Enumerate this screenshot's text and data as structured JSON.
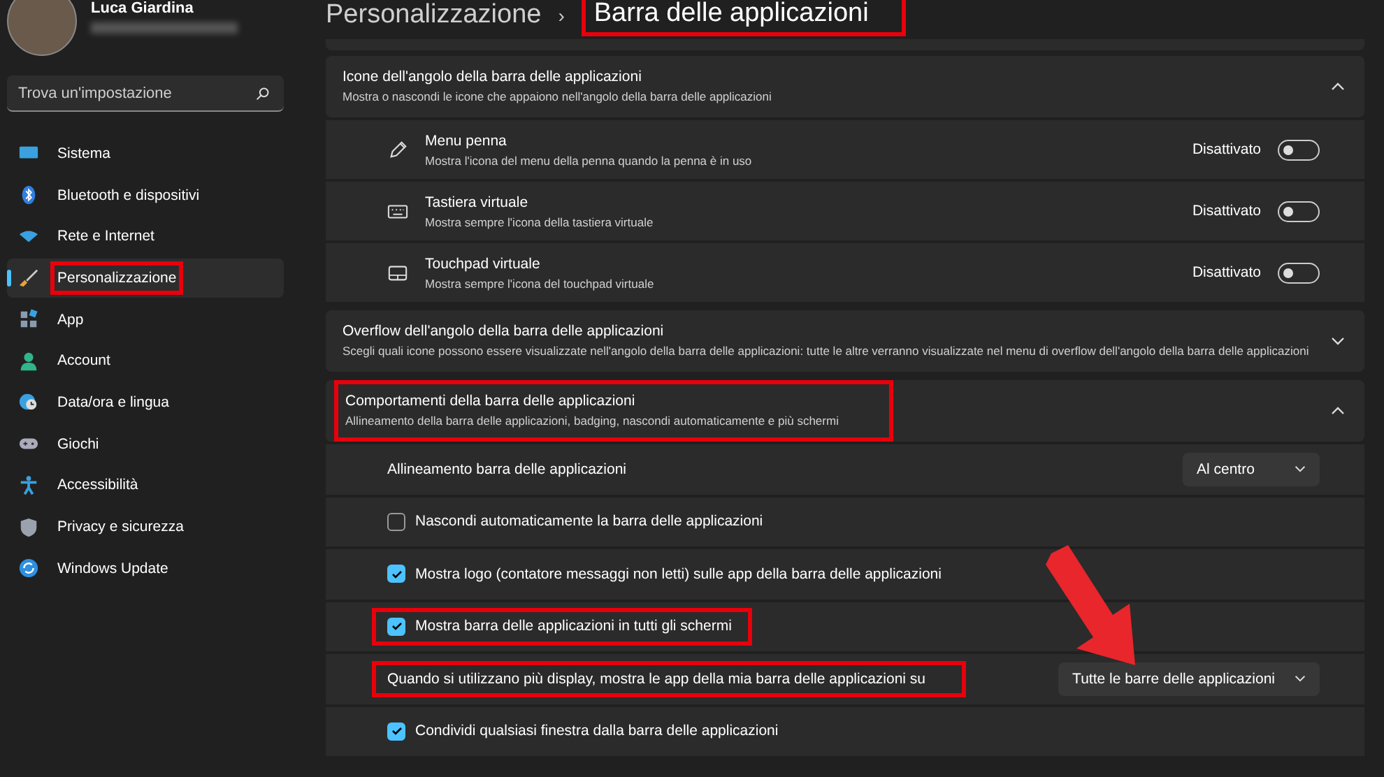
{
  "profile": {
    "name": "Luca Giardina"
  },
  "search": {
    "placeholder": "Trova un'impostazione"
  },
  "nav": [
    {
      "label": "Sistema",
      "selected": false,
      "highlighted": false
    },
    {
      "label": "Bluetooth e dispositivi",
      "selected": false,
      "highlighted": false
    },
    {
      "label": "Rete e Internet",
      "selected": false,
      "highlighted": false
    },
    {
      "label": "Personalizzazione",
      "selected": true,
      "highlighted": true
    },
    {
      "label": "App",
      "selected": false,
      "highlighted": false
    },
    {
      "label": "Account",
      "selected": false,
      "highlighted": false
    },
    {
      "label": "Data/ora e lingua",
      "selected": false,
      "highlighted": false
    },
    {
      "label": "Giochi",
      "selected": false,
      "highlighted": false
    },
    {
      "label": "Accessibilità",
      "selected": false,
      "highlighted": false
    },
    {
      "label": "Privacy e sicurezza",
      "selected": false,
      "highlighted": false
    },
    {
      "label": "Windows Update",
      "selected": false,
      "highlighted": false
    }
  ],
  "breadcrumb": {
    "parent": "Personalizzazione",
    "separator": "›",
    "current": "Barra delle applicazioni",
    "highlighted": true
  },
  "sections": [
    {
      "title": "Icone dell'angolo della barra delle applicazioni",
      "description": "Mostra o nascondi le icone che appaiono nell'angolo della barra delle applicazioni",
      "expanded": true,
      "highlighted": false,
      "items": [
        {
          "kind": "toggle",
          "title": "Menu penna",
          "description": "Mostra l'icona del menu della penna quando la penna è in uso",
          "status": "Disattivato",
          "on": false
        },
        {
          "kind": "toggle",
          "title": "Tastiera virtuale",
          "description": "Mostra sempre l'icona della tastiera virtuale",
          "status": "Disattivato",
          "on": false
        },
        {
          "kind": "toggle",
          "title": "Touchpad virtuale",
          "description": "Mostra sempre l'icona del touchpad virtuale",
          "status": "Disattivato",
          "on": false
        }
      ]
    },
    {
      "title": "Overflow dell'angolo della barra delle applicazioni",
      "description": "Scegli quali icone possono essere visualizzate nell'angolo della barra delle applicazioni: tutte le altre verranno visualizzate nel menu di overflow dell'angolo della barra delle applicazioni",
      "expanded": false,
      "highlighted": false
    },
    {
      "title": "Comportamenti della barra delle applicazioni",
      "description": "Allineamento della barra delle applicazioni, badging, nascondi automaticamente e più schermi",
      "expanded": true,
      "highlighted": true,
      "items": [
        {
          "kind": "dropdown",
          "label": "Allineamento barra delle applicazioni",
          "value": "Al centro",
          "highlighted": false
        },
        {
          "kind": "checkbox",
          "label": "Nascondi automaticamente la barra delle applicazioni",
          "checked": false,
          "highlighted": false
        },
        {
          "kind": "checkbox",
          "label": "Mostra logo (contatore messaggi non letti) sulle app della barra delle applicazioni",
          "checked": true,
          "highlighted": false
        },
        {
          "kind": "checkbox",
          "label": "Mostra barra delle applicazioni in tutti gli schermi",
          "checked": true,
          "highlighted": true
        },
        {
          "kind": "dropdown",
          "label": "Quando si utilizzano più display, mostra le app della mia barra delle applicazioni su",
          "value": "Tutte le barre delle applicazioni",
          "highlighted": true
        },
        {
          "kind": "checkbox",
          "label": "Condividi qualsiasi finestra dalla barra delle applicazioni",
          "checked": true,
          "highlighted": false
        }
      ]
    }
  ]
}
